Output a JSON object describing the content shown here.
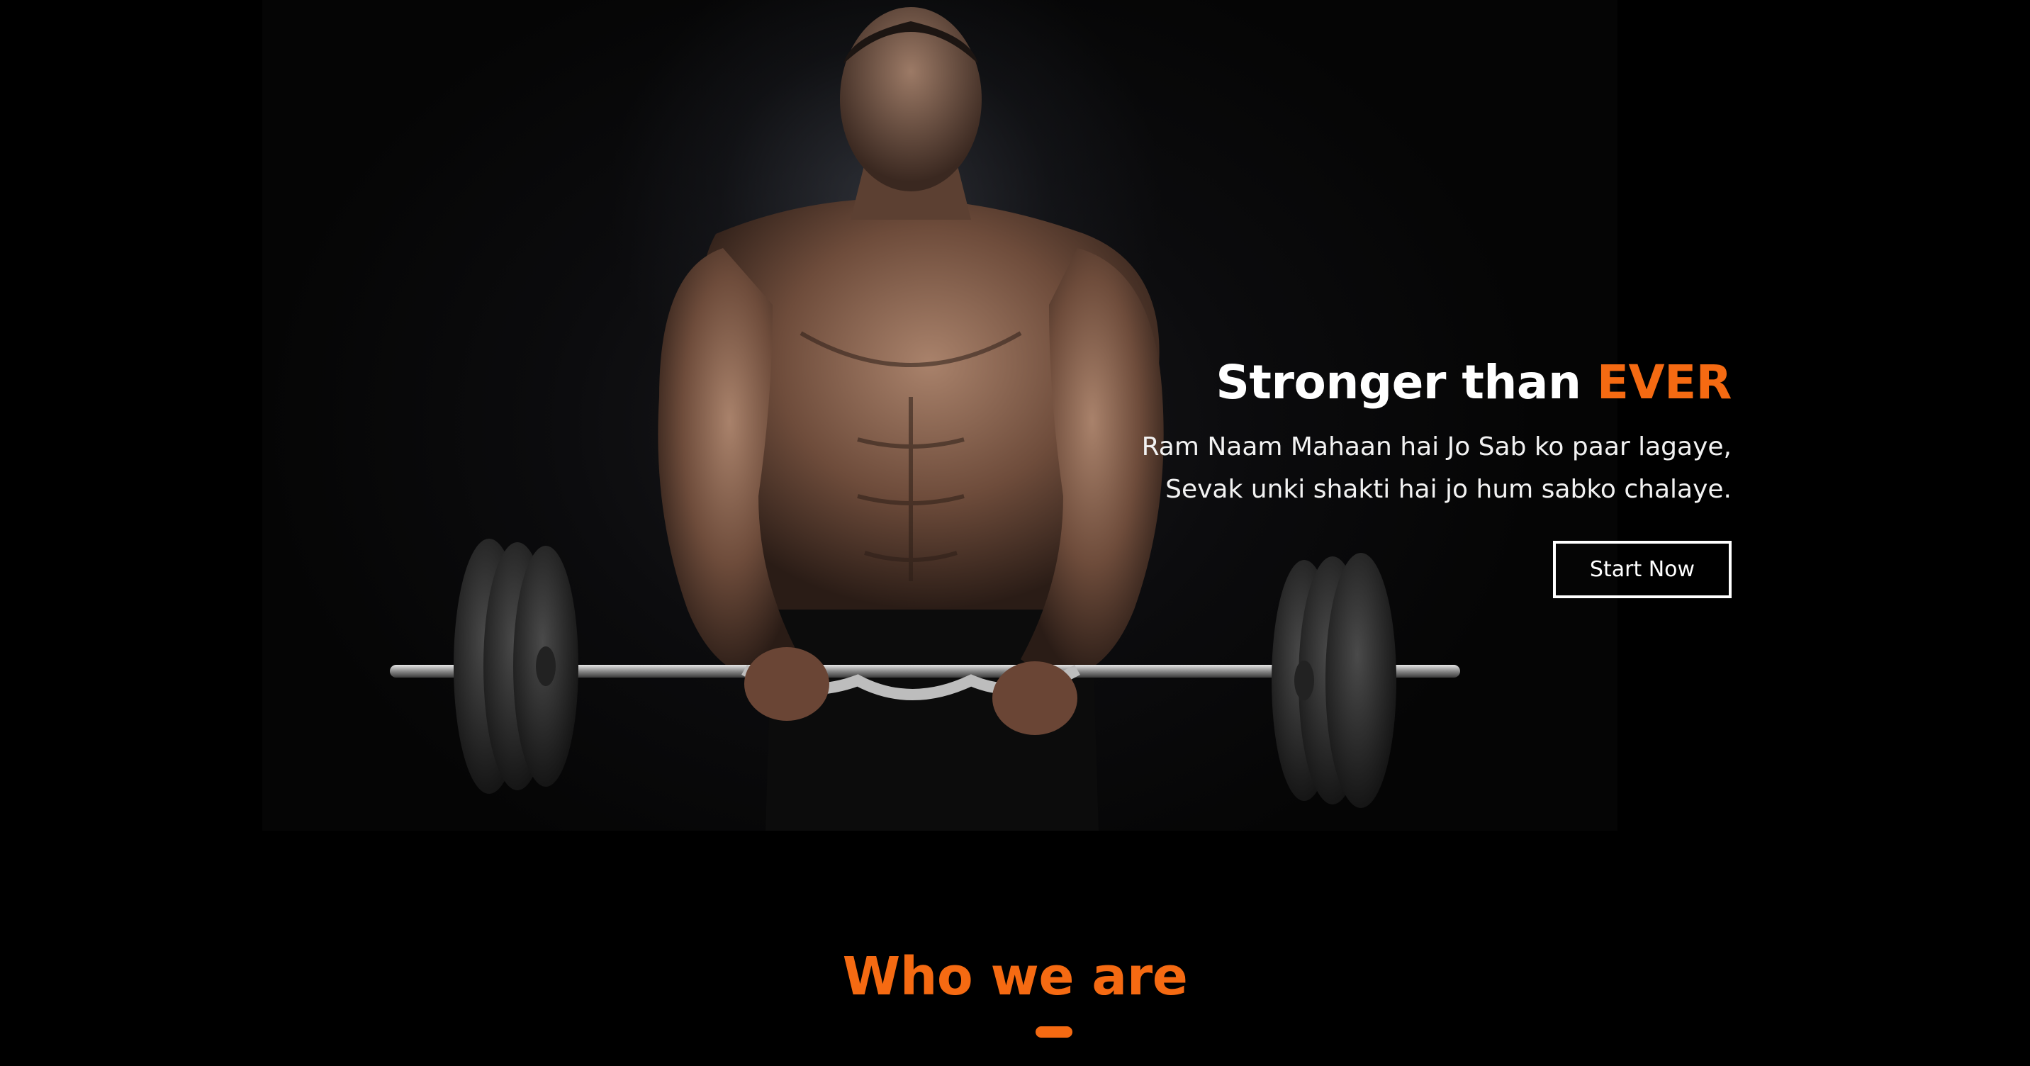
{
  "hero": {
    "title_prefix": "Stronger than ",
    "title_accent": "EVER",
    "subtitle_line1": "Ram Naam Mahaan hai Jo Sab ko paar lagaye,",
    "subtitle_line2": "Sevak unki shakti hai jo hum sabko chalaye.",
    "cta_label": "Start Now",
    "image_subject": "man-lifting-barbell"
  },
  "about": {
    "title": "Who we are"
  },
  "colors": {
    "accent": "#f56a12",
    "background": "#000000",
    "text": "#ffffff"
  }
}
